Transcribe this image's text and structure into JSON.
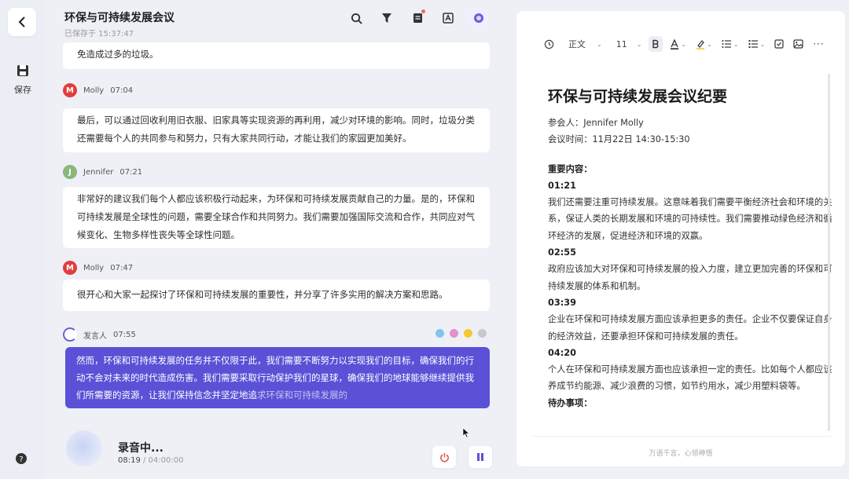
{
  "header": {
    "title": "环保与可持续发展会议",
    "saved": "已保存于 15:37:47"
  },
  "rail": {
    "save_label": "保存"
  },
  "messages": [
    {
      "text": "免造成过多的垃圾。"
    },
    {
      "speaker": "Molly",
      "time": "07:04",
      "avatar": "M",
      "text": "最后，可以通过回收利用旧衣服、旧家具等实现资源的再利用，减少对环境的影响。同时，垃圾分类还需要每个人的共同参与和努力，只有大家共同行动，才能让我们的家园更加美好。"
    },
    {
      "speaker": "Jennifer",
      "time": "07:21",
      "avatar": "J",
      "text": "非常好的建议我们每个人都应该积极行动起来，为环保和可持续发展贡献自己的力量。是的，环保和可持续发展是全球性的问题，需要全球合作和共同努力。我们需要加强国际交流和合作，共同应对气候变化、生物多样性丧失等全球性问题。"
    },
    {
      "speaker": "Molly",
      "time": "07:47",
      "avatar": "M",
      "text": "很开心和大家一起探讨了环保和可持续发展的重要性，并分享了许多实用的解决方案和思路。"
    }
  ],
  "current": {
    "speaker": "发言人",
    "time": "07:55",
    "text": "然而，环保和可持续发展的任务并不仅限于此，我们需要不断努力以实现我们的目标，确保我们的行动不会对未来的时代造成伤害。我们需要采取行动保护我们的星球，确保我们的地球能够继续提供我们所需要的资源，让我们保持信念并坚定地追",
    "text_dim": "求环保和可持续发展的",
    "dot_colors": [
      "#7fc6ec",
      "#e58ed1",
      "#f2c932",
      "#c7c9ce"
    ]
  },
  "recording": {
    "status": "录音中...",
    "elapsed": "08:19",
    "total": " / 04:00:00"
  },
  "editor": {
    "toolbar": {
      "style": "正文",
      "size": "11"
    },
    "title": "环保与可持续发展会议纪要",
    "participants": "参会人：Jennifer Molly",
    "meeting_time": "会议时间：11月22日 14:30-15:30",
    "key_heading": "重要内容：",
    "items": [
      {
        "time": "01:21",
        "text": "我们还需要注重可持续发展。这意味着我们需要平衡经济社会和环境的关系，保证人类的长期发展和环境的可持续性。我们需要推动绿色经济和循环经济的发展，促进经济和环境的双赢。"
      },
      {
        "time": "02:55",
        "text": "政府应该加大对环保和可持续发展的投入力度，建立更加完善的环保和可持续发展的体系和机制。"
      },
      {
        "time": "03:39",
        "text": "企业在环保和可持续发展方面应该承担更多的责任。企业不仅要保证自身的经济效益，还要承担环保和可持续发展的责任。"
      },
      {
        "time": "04:20",
        "text": "个人在环保和可持续发展方面也应该承担一定的责任。比如每个人都应该养成节约能源、减少浪费的习惯，如节约用水，减少用塑料袋等。"
      }
    ],
    "todo_heading": "待办事项：",
    "footer": "万语千言，心领神悟"
  }
}
